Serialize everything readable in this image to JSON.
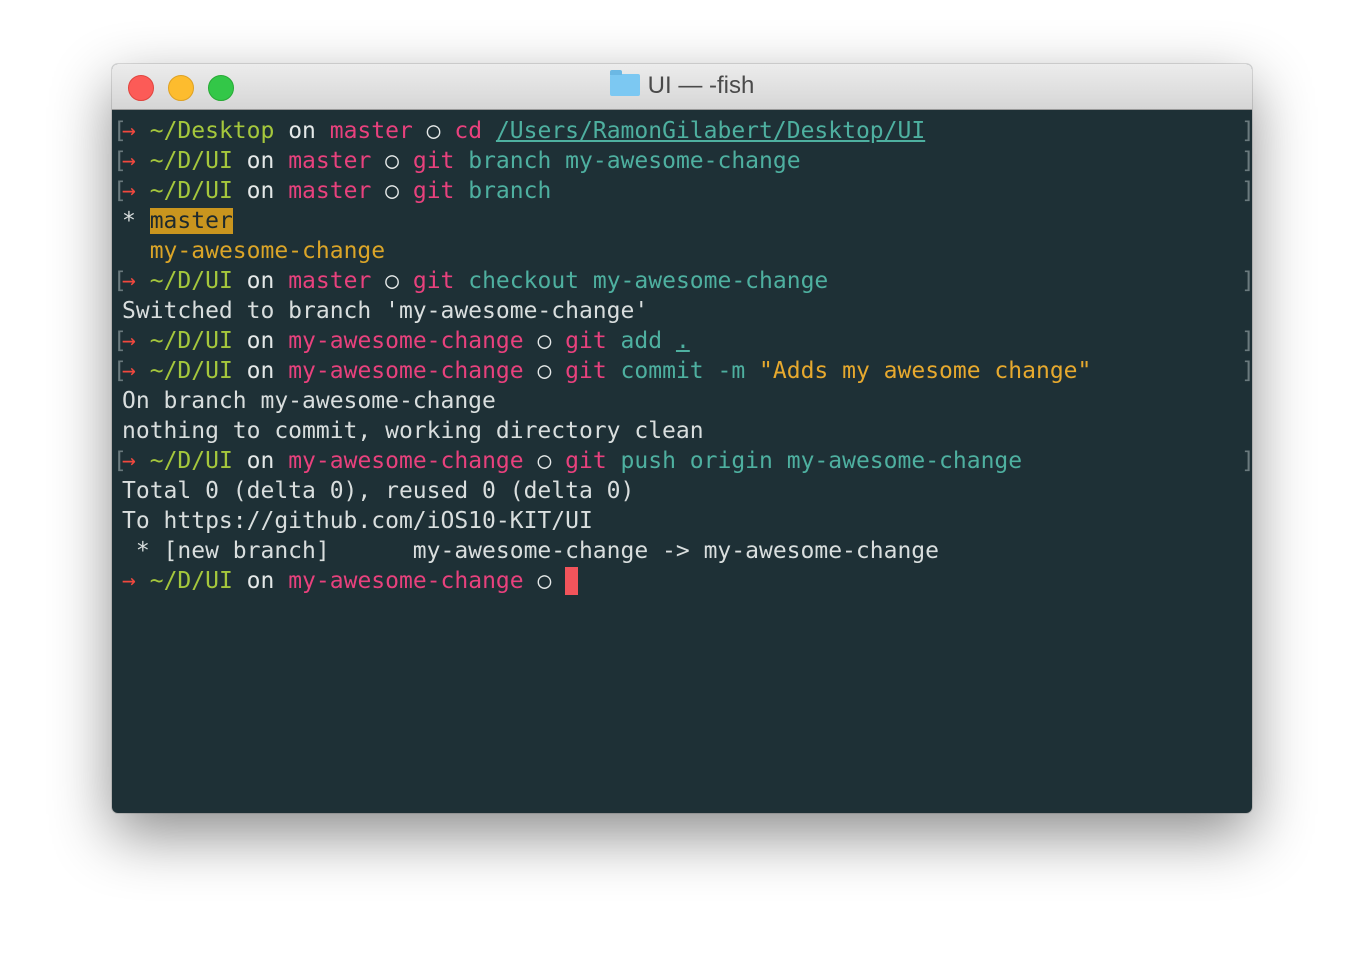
{
  "window": {
    "title": "UI — -fish",
    "folder_icon": "folder-icon"
  },
  "colors": {
    "background": "#1e3036",
    "path": "#a5c73c",
    "branch": "#e8417d",
    "argument": "#4eb0a0",
    "string": "#e7a92e",
    "cursor": "#f2545b"
  },
  "terminal": {
    "lines": [
      {
        "bracket": true,
        "segs": [
          [
            "→",
            "arrow"
          ],
          [
            " "
          ],
          [
            "~/Desktop",
            "path"
          ],
          [
            " on ",
            "on"
          ],
          [
            "master",
            "branch"
          ],
          [
            " ○ ",
            "on"
          ],
          [
            "cd",
            "cmd"
          ],
          [
            " "
          ],
          [
            "/Users/RamonGilabert/Desktop/UI",
            "arg u"
          ]
        ]
      },
      {
        "bracket": true,
        "segs": [
          [
            "→",
            "arrow"
          ],
          [
            " "
          ],
          [
            "~/D/UI",
            "path"
          ],
          [
            " on ",
            "on"
          ],
          [
            "master",
            "branch"
          ],
          [
            " ○ ",
            "on"
          ],
          [
            "git",
            "cmd"
          ],
          [
            " branch my-awesome-change",
            "arg"
          ]
        ]
      },
      {
        "bracket": true,
        "segs": [
          [
            "→",
            "arrow"
          ],
          [
            " "
          ],
          [
            "~/D/UI",
            "path"
          ],
          [
            " on ",
            "on"
          ],
          [
            "master",
            "branch"
          ],
          [
            " ○ ",
            "on"
          ],
          [
            "git",
            "cmd"
          ],
          [
            " branch",
            "arg"
          ]
        ]
      },
      {
        "bracket": false,
        "segs": [
          [
            "* ",
            "out"
          ],
          [
            "master",
            "hl"
          ]
        ]
      },
      {
        "bracket": false,
        "segs": [
          [
            "  "
          ],
          [
            "my-awesome-change",
            "yellow"
          ]
        ]
      },
      {
        "bracket": true,
        "segs": [
          [
            "→",
            "arrow"
          ],
          [
            " "
          ],
          [
            "~/D/UI",
            "path"
          ],
          [
            " on ",
            "on"
          ],
          [
            "master",
            "branch"
          ],
          [
            " ○ ",
            "on"
          ],
          [
            "git",
            "cmd"
          ],
          [
            " checkout my-awesome-change",
            "arg"
          ]
        ]
      },
      {
        "bracket": false,
        "segs": [
          [
            "Switched to branch 'my-awesome-change'",
            "out"
          ]
        ]
      },
      {
        "bracket": true,
        "segs": [
          [
            "→",
            "arrow"
          ],
          [
            " "
          ],
          [
            "~/D/UI",
            "path"
          ],
          [
            " on ",
            "on"
          ],
          [
            "my-awesome-change",
            "branch"
          ],
          [
            " ○ ",
            "on"
          ],
          [
            "git",
            "cmd"
          ],
          [
            " add ",
            "arg"
          ],
          [
            ".",
            "arg u"
          ]
        ]
      },
      {
        "bracket": true,
        "segs": [
          [
            "→",
            "arrow"
          ],
          [
            " "
          ],
          [
            "~/D/UI",
            "path"
          ],
          [
            " on ",
            "on"
          ],
          [
            "my-awesome-change",
            "branch"
          ],
          [
            " ○ ",
            "on"
          ],
          [
            "git",
            "cmd"
          ],
          [
            " commit -m ",
            "arg"
          ],
          [
            "\"Adds my awesome change\"",
            "str"
          ]
        ]
      },
      {
        "bracket": false,
        "segs": [
          [
            "On branch my-awesome-change",
            "out"
          ]
        ]
      },
      {
        "bracket": false,
        "segs": [
          [
            "nothing to commit, working directory clean",
            "out"
          ]
        ]
      },
      {
        "bracket": true,
        "segs": [
          [
            "→",
            "arrow"
          ],
          [
            " "
          ],
          [
            "~/D/UI",
            "path"
          ],
          [
            " on ",
            "on"
          ],
          [
            "my-awesome-change",
            "branch"
          ],
          [
            " ○ ",
            "on"
          ],
          [
            "git",
            "cmd"
          ],
          [
            " push origin my-awesome-change",
            "arg"
          ]
        ]
      },
      {
        "bracket": false,
        "segs": [
          [
            "Total 0 (delta 0), reused 0 (delta 0)",
            "out"
          ]
        ]
      },
      {
        "bracket": false,
        "segs": [
          [
            "To https://github.com/iOS10-KIT/UI",
            "out"
          ]
        ]
      },
      {
        "bracket": false,
        "segs": [
          [
            " * [new branch]      my-awesome-change -> my-awesome-change",
            "out"
          ]
        ]
      },
      {
        "bracket": false,
        "cursor": true,
        "segs": [
          [
            "→",
            "arrow"
          ],
          [
            " "
          ],
          [
            "~/D/UI",
            "path"
          ],
          [
            " on ",
            "on"
          ],
          [
            "my-awesome-change",
            "branch"
          ],
          [
            " ○ ",
            "on"
          ]
        ]
      }
    ]
  }
}
